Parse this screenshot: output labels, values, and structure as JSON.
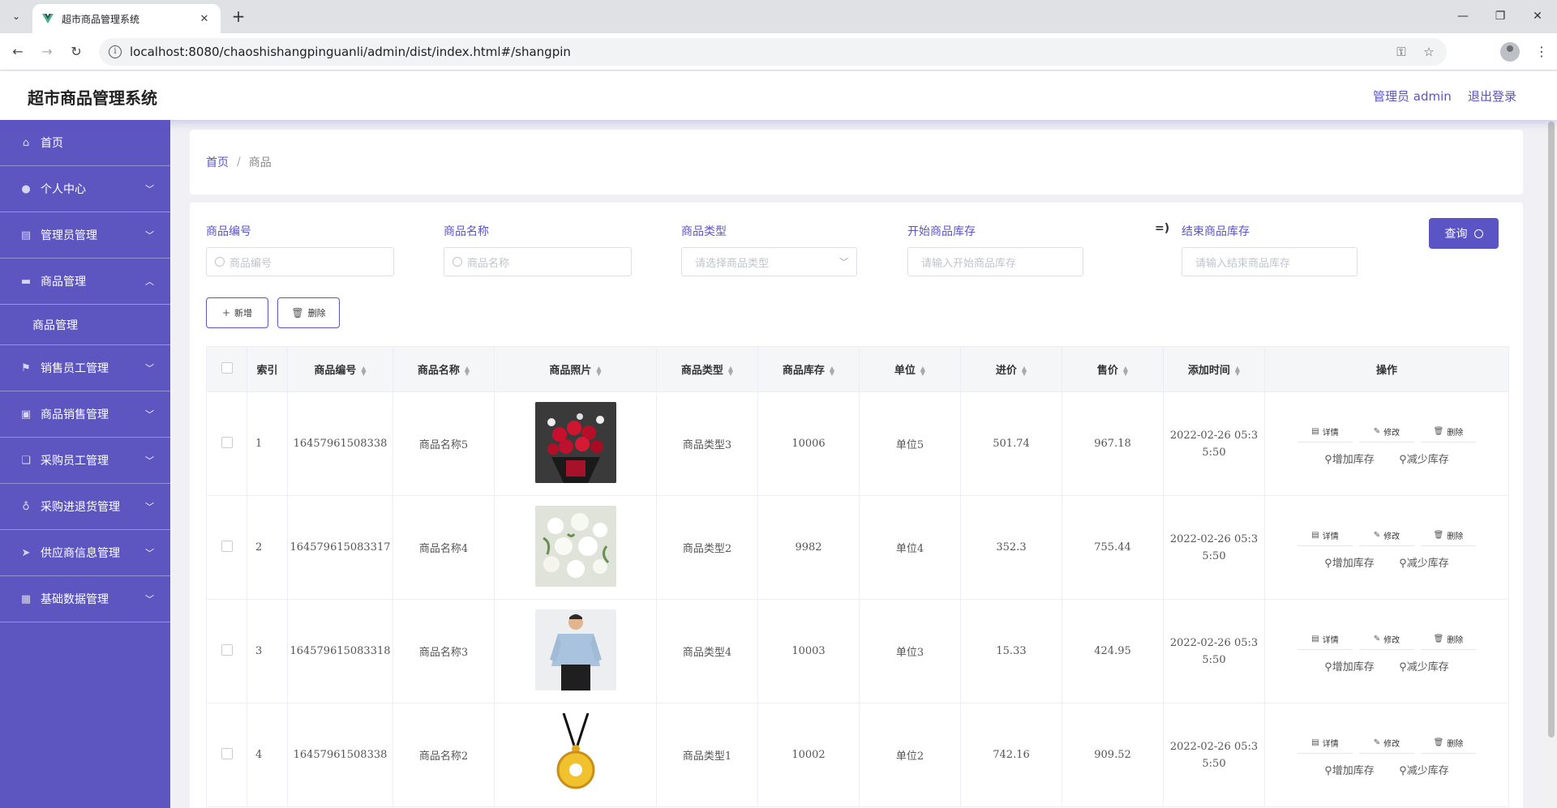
{
  "browser": {
    "tab_title": "超市商品管理系统",
    "url": "localhost:8080/chaoshishangpinguanli/admin/dist/index.html#/shangpin"
  },
  "header": {
    "title": "超市商品管理系统",
    "user": "管理员 admin",
    "logout": "退出登录"
  },
  "sidebar": {
    "items": [
      {
        "label": "首页",
        "icon": "home-icon"
      },
      {
        "label": "个人中心",
        "icon": "user-icon"
      },
      {
        "label": "管理员管理",
        "icon": "clipboard-icon"
      },
      {
        "label": "商品管理",
        "icon": "tag-icon",
        "expanded": true
      },
      {
        "label": "销售员工管理",
        "icon": "flag-icon"
      },
      {
        "label": "商品销售管理",
        "icon": "briefcase-icon"
      },
      {
        "label": "采购员工管理",
        "icon": "copy-icon"
      },
      {
        "label": "采购进退货管理",
        "icon": "mic-icon"
      },
      {
        "label": "供应商信息管理",
        "icon": "send-icon"
      },
      {
        "label": "基础数据管理",
        "icon": "grid-icon"
      }
    ],
    "sub_item": "商品管理"
  },
  "breadcrumb": {
    "home": "首页",
    "separator": "/",
    "current": "商品"
  },
  "filters": {
    "code_label": "商品编号",
    "code_placeholder": "商品编号",
    "name_label": "商品名称",
    "name_placeholder": "商品名称",
    "type_label": "商品类型",
    "type_placeholder": "请选择商品类型",
    "stock_start_label": "开始商品库存",
    "stock_start_placeholder": "请输入开始商品库存",
    "stock_arrow": "=)",
    "stock_end_label": "结束商品库存",
    "stock_end_placeholder": "请输入结束商品库存",
    "query_button": "查询"
  },
  "actions": {
    "add": "新增",
    "delete": "删除"
  },
  "table": {
    "columns": [
      "索引",
      "商品编号",
      "商品名称",
      "商品照片",
      "商品类型",
      "商品库存",
      "单位",
      "进价",
      "售价",
      "添加时间",
      "操作"
    ],
    "row_actions": {
      "detail": "详情",
      "edit": "修改",
      "delete": "删除",
      "add_stock": "增加库存",
      "reduce_stock": "减少库存"
    },
    "rows": [
      {
        "index": "1",
        "code": "16457961508338",
        "name": "商品名称5",
        "photo": "rose-bouquet",
        "type": "商品类型3",
        "stock": "10006",
        "unit": "单位5",
        "cost": "501.74",
        "price": "967.18",
        "time_l1": "2022-02-26 05:3",
        "time_l2": "5:50"
      },
      {
        "index": "2",
        "code": "164579615083317",
        "name": "商品名称4",
        "photo": "white-flowers",
        "type": "商品类型2",
        "stock": "9982",
        "unit": "单位4",
        "cost": "352.3",
        "price": "755.44",
        "time_l1": "2022-02-26 05:3",
        "time_l2": "5:50"
      },
      {
        "index": "3",
        "code": "164579615083318",
        "name": "商品名称3",
        "photo": "blue-shirt-man",
        "type": "商品类型4",
        "stock": "10003",
        "unit": "单位3",
        "cost": "15.33",
        "price": "424.95",
        "time_l1": "2022-02-26 05:3",
        "time_l2": "5:50"
      },
      {
        "index": "4",
        "code": "16457961508338",
        "name": "商品名称2",
        "photo": "gold-pendant",
        "type": "商品类型1",
        "stock": "10002",
        "unit": "单位2",
        "cost": "742.16",
        "price": "909.52",
        "time_l1": "2022-02-26 05:3",
        "time_l2": "5:50"
      }
    ]
  },
  "colors": {
    "accent": "#5b54c4",
    "sidebar": "#5d56c1"
  }
}
